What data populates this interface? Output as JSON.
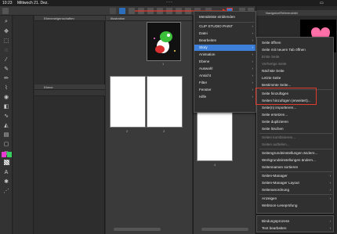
{
  "status": {
    "time": "10:23",
    "date": "Mittwoch 21. Dez."
  },
  "panels": {
    "sub_tool_title": "Ebenenelgenschaften",
    "ebene_title": "Ebene"
  },
  "page_manager": {
    "tab_title": "Illustration",
    "pages": [
      {
        "number": "1"
      },
      {
        "number": "2"
      },
      {
        "number": "3"
      }
    ],
    "right_pages": [
      {
        "number": "4"
      }
    ],
    "zoom_left": "",
    "zoom_right": ""
  },
  "navigator": {
    "title": "Navigator/Referenzbild"
  },
  "main_menu": {
    "items": [
      {
        "label": "Menüleiste einblenden",
        "submenu": false,
        "highlight": false
      },
      {
        "label": "CLIP STUDIO PAINT",
        "submenu": true,
        "highlight": false
      },
      {
        "label": "Datei",
        "submenu": true,
        "highlight": false
      },
      {
        "label": "Bearbeiten",
        "submenu": true,
        "highlight": false
      },
      {
        "label": "Story",
        "submenu": true,
        "highlight": true
      },
      {
        "label": "Animation",
        "submenu": true,
        "highlight": false
      },
      {
        "label": "Ebene",
        "submenu": true,
        "highlight": false
      },
      {
        "label": "Auswahl",
        "submenu": true,
        "highlight": false
      },
      {
        "label": "Ansicht",
        "submenu": true,
        "highlight": false
      },
      {
        "label": "Filter",
        "submenu": true,
        "highlight": false
      },
      {
        "label": "Fenster",
        "submenu": true,
        "highlight": false
      },
      {
        "label": "Hilfe",
        "submenu": true,
        "highlight": false
      }
    ]
  },
  "story_menu": {
    "items": [
      {
        "label": "Seite öffnen",
        "dim": false,
        "submenu": false
      },
      {
        "label": "Seite mit neuem Tab öffnen",
        "dim": false,
        "submenu": false
      },
      {
        "label": "Erste Seite",
        "dim": true,
        "submenu": false
      },
      {
        "label": "Vorherige Seite",
        "dim": true,
        "submenu": false
      },
      {
        "label": "Nächste Seite",
        "dim": false,
        "submenu": false
      },
      {
        "label": "Letzte Seite",
        "dim": false,
        "submenu": false
      },
      {
        "label": "Bestimmte Seite...",
        "dim": false,
        "submenu": false
      },
      {
        "label": "Seite hinzufügen",
        "dim": false,
        "submenu": false
      },
      {
        "label": "Seiten hinzufügen (erweitert)...",
        "dim": false,
        "submenu": false
      },
      {
        "label": "Seite(n) importieren...",
        "dim": false,
        "submenu": false
      },
      {
        "label": "Seite ersetzen...",
        "dim": false,
        "submenu": false
      },
      {
        "label": "Seite duplizieren",
        "dim": false,
        "submenu": false
      },
      {
        "label": "Seite löschen",
        "dim": false,
        "submenu": false
      },
      {
        "label": "Seiten kombinieren...",
        "dim": true,
        "submenu": false
      },
      {
        "label": "Seiten aufteilen...",
        "dim": true,
        "submenu": false
      },
      {
        "label": "Seitengrundeinstellungen ändern...",
        "dim": false,
        "submenu": false
      },
      {
        "label": "Werkgrundeinstellungen ändern...",
        "dim": false,
        "submenu": false
      },
      {
        "label": "Seitennamen sortieren",
        "dim": false,
        "submenu": false
      },
      {
        "label": "Seiten-Manager",
        "dim": false,
        "submenu": true
      },
      {
        "label": "Seiten-Manager Layout",
        "dim": false,
        "submenu": true
      },
      {
        "label": "Seitenanordnung",
        "dim": false,
        "submenu": true
      },
      {
        "label": "Anzeigen",
        "dim": false,
        "submenu": true
      },
      {
        "label": "Webtoon-Leseprüfung",
        "dim": false,
        "submenu": false
      },
      {
        "label": "Bindungsprozess",
        "dim": false,
        "submenu": true
      },
      {
        "label": "Text bearbeiten",
        "dim": false,
        "submenu": true
      }
    ]
  },
  "colors": {
    "highlight": "#3d7fd9",
    "annotation_red": "#e23b2e",
    "swatch_pink": "#e83ad0",
    "swatch_green": "#38d060"
  },
  "icons": [
    "home-icon",
    "menu-icon",
    "brush-icon",
    "move-icon",
    "zoom-icon",
    "pen-icon",
    "eraser-icon",
    "fill-icon",
    "text-icon",
    "select-icon"
  ]
}
